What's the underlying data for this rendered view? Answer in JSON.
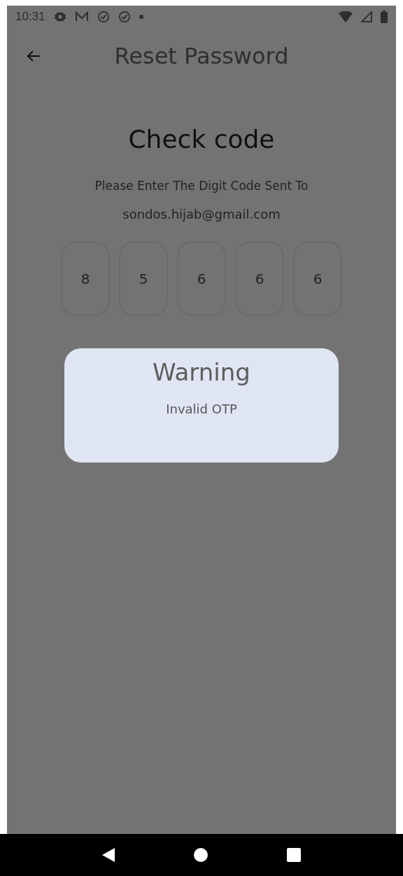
{
  "status_bar": {
    "time": "10:31"
  },
  "header": {
    "title": "Reset Password"
  },
  "heading": "Check code",
  "instruction": "Please Enter The Digit Code Sent To",
  "email": "sondos.hijab@gmail.com",
  "code_digits": [
    "8",
    "5",
    "6",
    "6",
    "6"
  ],
  "dialog": {
    "title": "Warning",
    "message": "Invalid OTP"
  }
}
